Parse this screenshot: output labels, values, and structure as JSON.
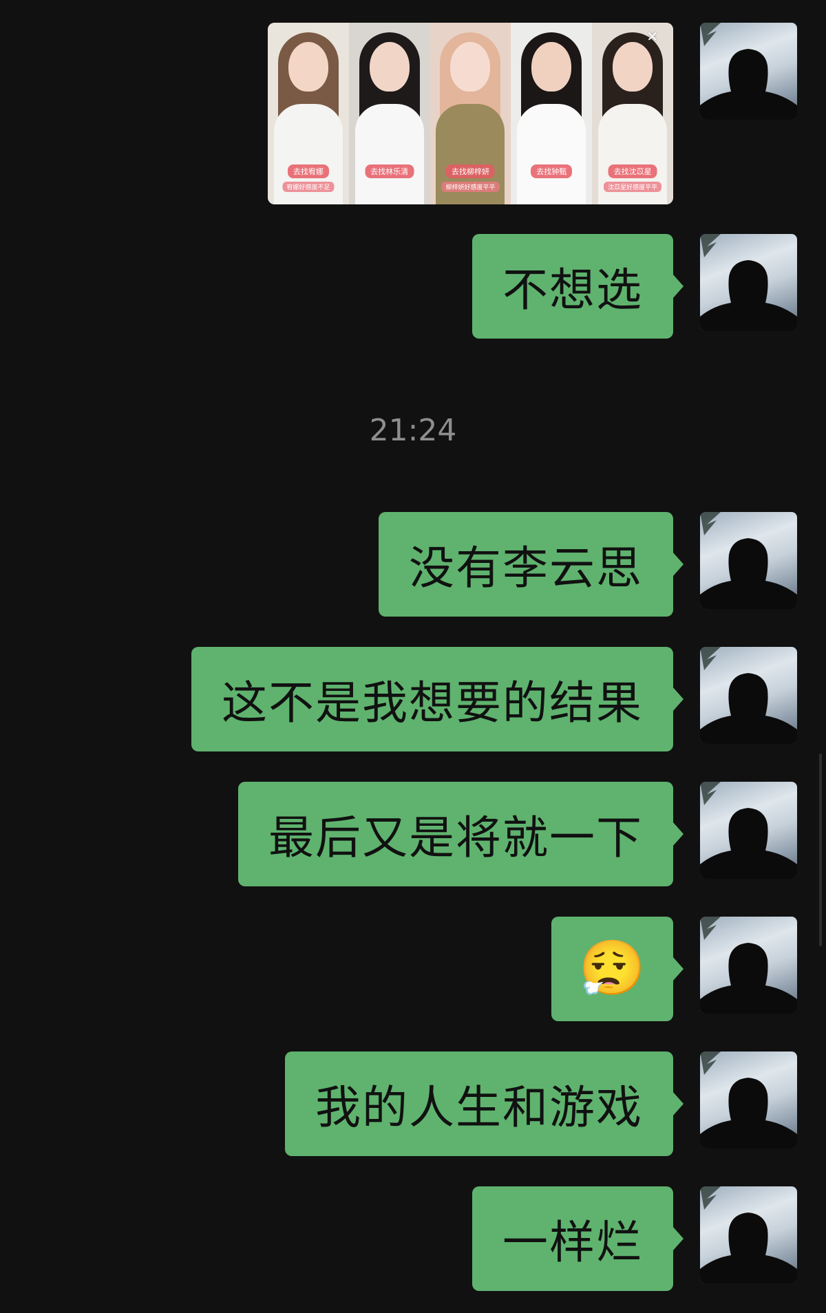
{
  "timestamp": "21:24",
  "photo_card": {
    "close_icon": "close-icon",
    "pills": [
      "去找宥娜",
      "去找林乐清",
      "去找柳梓妍",
      "去找钟甄",
      "去找沈苡星"
    ],
    "subs": [
      "宥娜好感度不足",
      "",
      "柳梓妍好感度平平",
      "",
      "沈苡星好感度平平"
    ]
  },
  "messages": [
    {
      "text": "不想选"
    },
    {
      "text": "没有李云思"
    },
    {
      "text": "这不是我想要的结果"
    },
    {
      "text": "最后又是将就一下"
    },
    {
      "emoji": "😮‍💨"
    },
    {
      "text": "我的人生和游戏"
    },
    {
      "text": "一样烂"
    }
  ],
  "colors": {
    "background": "#111111",
    "bubble": "#5fb36e",
    "timestamp": "#8e8e8e"
  }
}
